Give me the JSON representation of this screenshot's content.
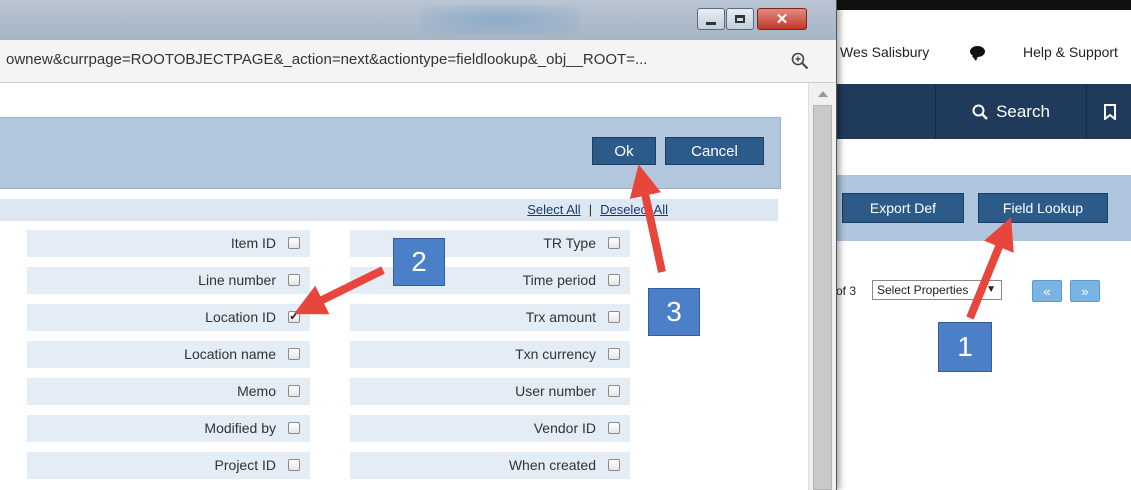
{
  "background": {
    "user_name": "Wes Salisbury",
    "help_label": "Help & Support",
    "search_label": "Search",
    "export_label": "Export Def",
    "lookup_label": "Field Lookup",
    "pager_text": "of 3",
    "select_value": "Select Properties",
    "prev_label": "«",
    "next_label": "»",
    "icons": [
      "chat-icon",
      "search-icon",
      "bookmark-icon"
    ]
  },
  "popup": {
    "url": "ownew&currpage=ROOTOBJECTPAGE&_action=next&actiontype=fieldlookup&_obj__ROOT=...",
    "window_buttons": [
      "minimize",
      "maximize",
      "close"
    ],
    "ok_label": "Ok",
    "cancel_label": "Cancel",
    "select_all_label": "Select All",
    "separator": "|",
    "deselect_all_label": "Deselect All",
    "fields_left": [
      {
        "label": "Item ID",
        "checked": false
      },
      {
        "label": "Line number",
        "checked": false
      },
      {
        "label": "Location ID",
        "checked": true
      },
      {
        "label": "Location name",
        "checked": false
      },
      {
        "label": "Memo",
        "checked": false
      },
      {
        "label": "Modified by",
        "checked": false
      },
      {
        "label": "Project ID",
        "checked": false
      }
    ],
    "fields_right": [
      {
        "label": "TR Type",
        "checked": false
      },
      {
        "label": "Time period",
        "checked": false
      },
      {
        "label": "Trx amount",
        "checked": false
      },
      {
        "label": "Txn currency",
        "checked": false
      },
      {
        "label": "User number",
        "checked": false
      },
      {
        "label": "Vendor ID",
        "checked": false
      },
      {
        "label": "When created",
        "checked": false
      }
    ]
  },
  "annotations": {
    "step1": "1",
    "step2": "2",
    "step3": "3",
    "arrow_color": "#e8453c",
    "badge_color": "#4b7fc8"
  }
}
